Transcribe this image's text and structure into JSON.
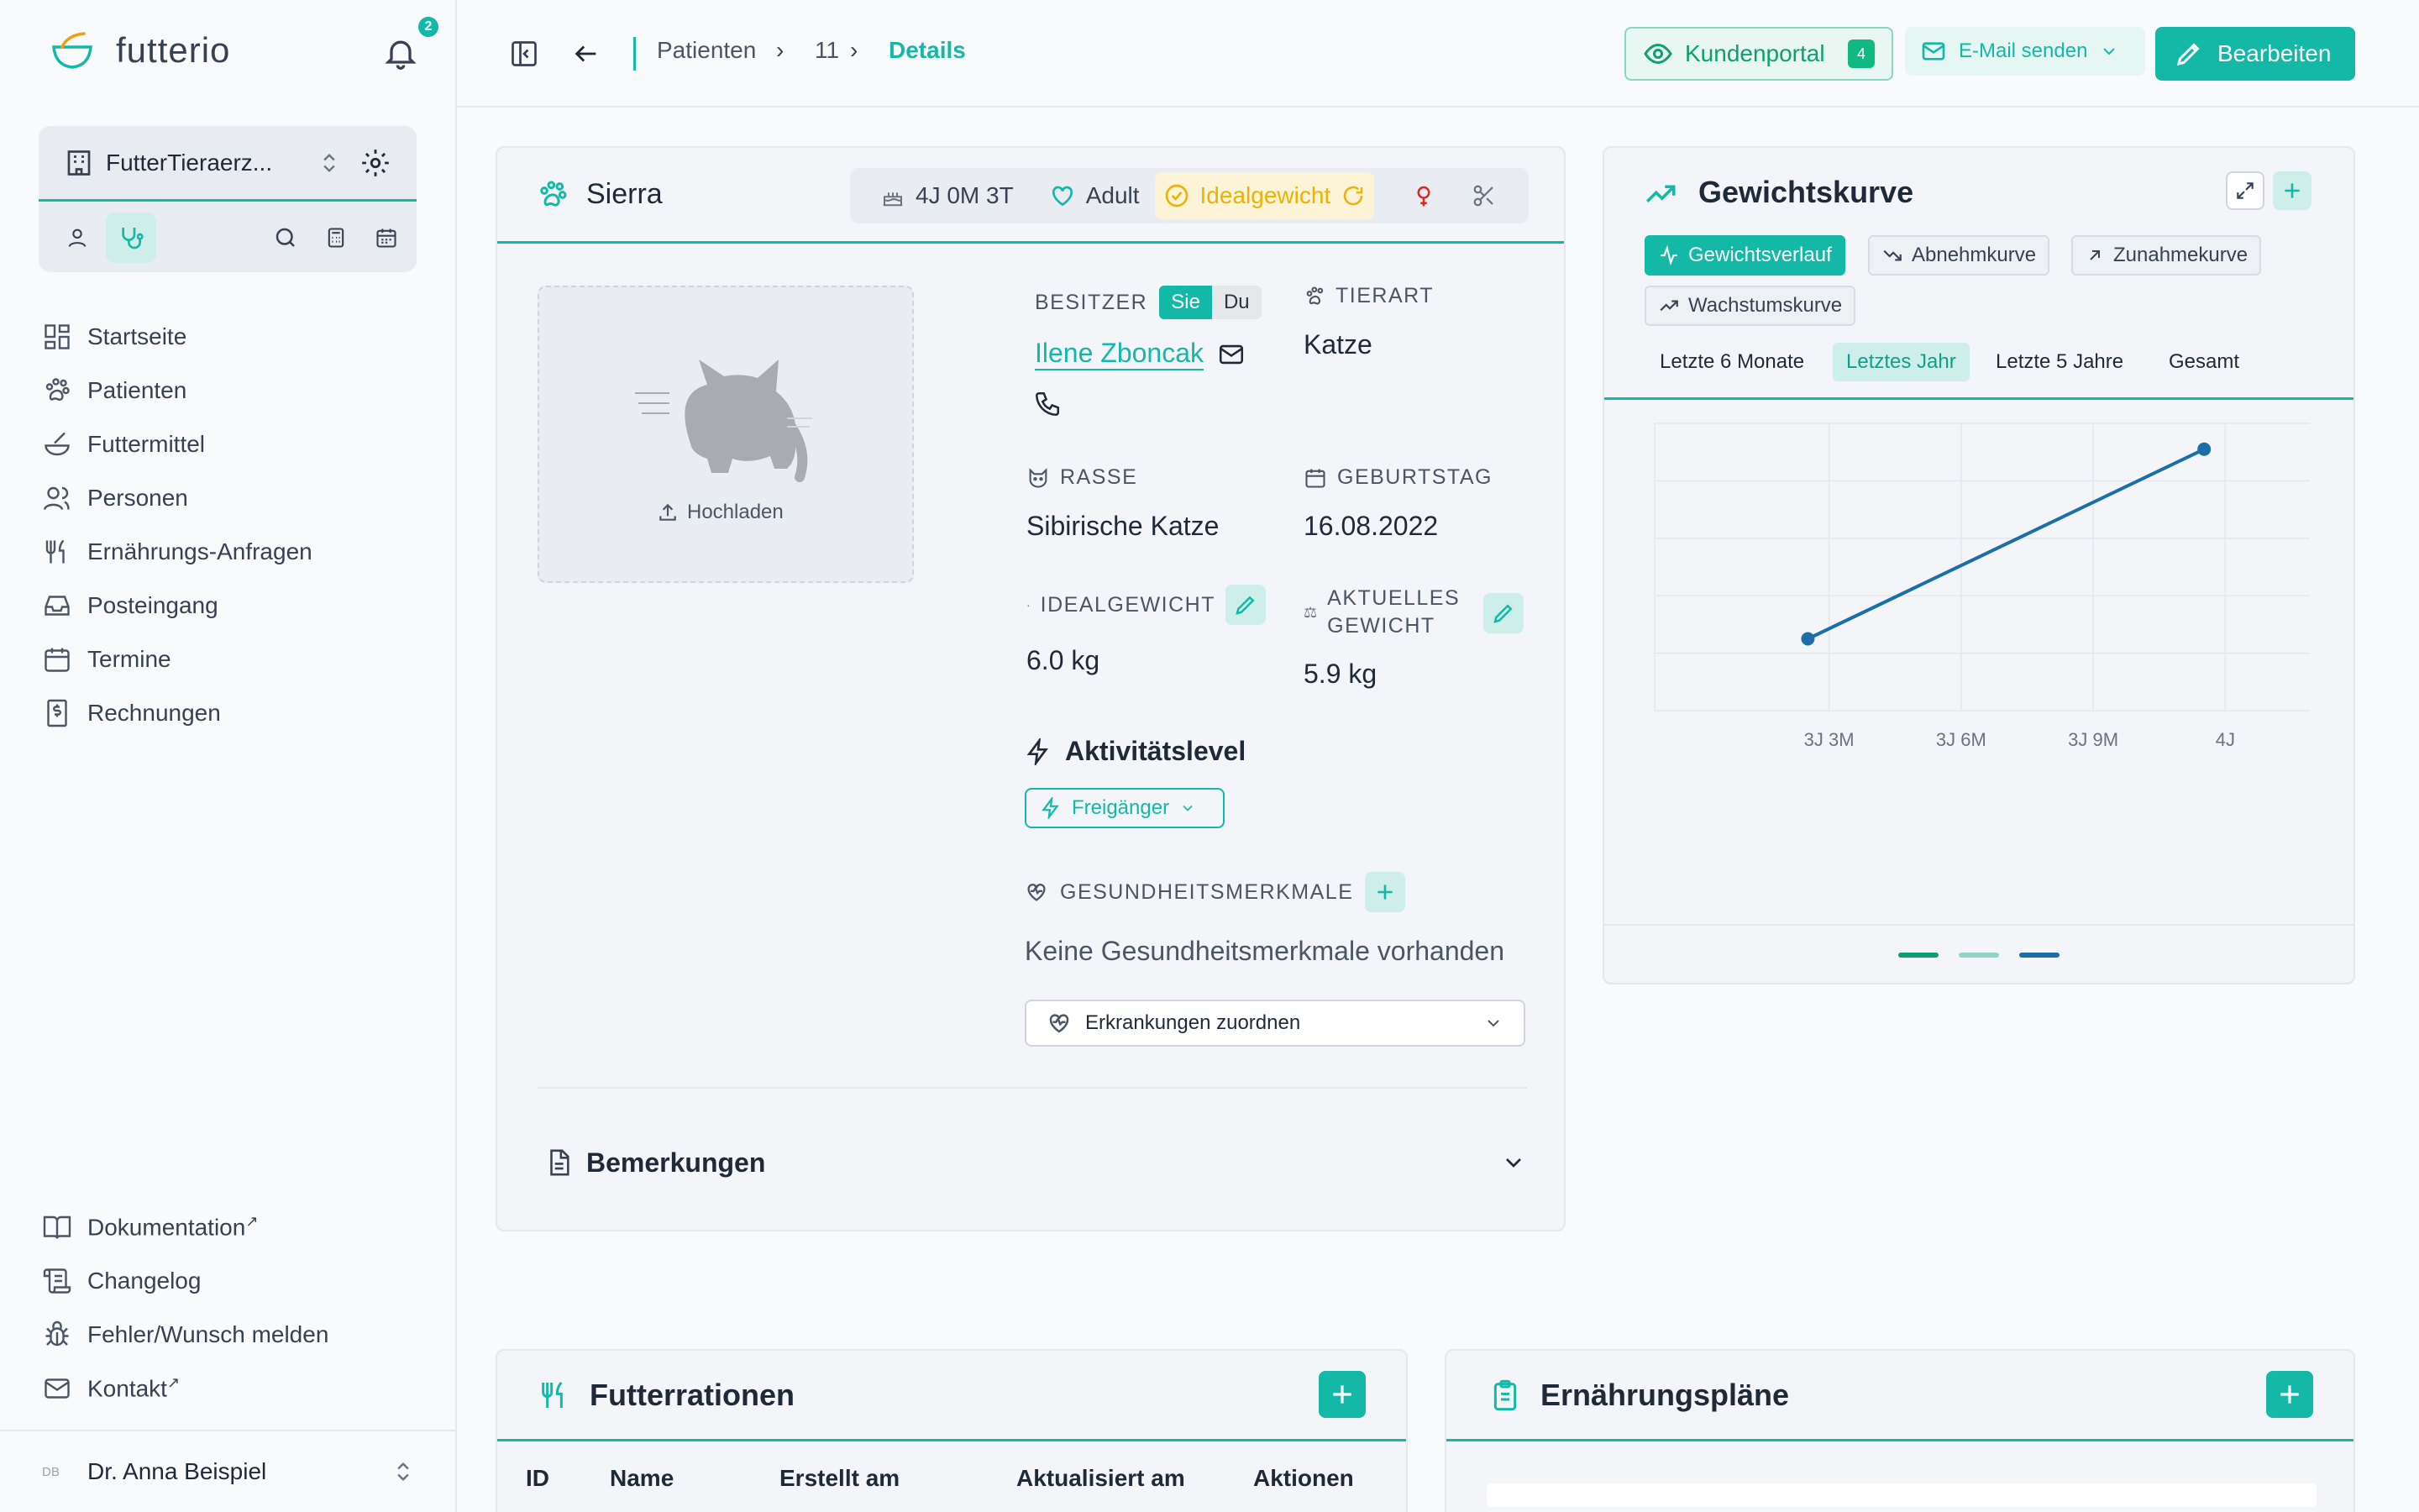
{
  "app": {
    "name": "futterio",
    "notifications": "2"
  },
  "org": {
    "name": "FutterTieraerz..."
  },
  "nav": {
    "items": [
      {
        "label": "Startseite",
        "icon": "dashboard-icon"
      },
      {
        "label": "Patienten",
        "icon": "paw-icon"
      },
      {
        "label": "Futtermittel",
        "icon": "bowl-icon"
      },
      {
        "label": "Personen",
        "icon": "people-icon"
      },
      {
        "label": "Ernährungs-Anfragen",
        "icon": "utensils-icon"
      },
      {
        "label": "Posteingang",
        "icon": "inbox-icon"
      },
      {
        "label": "Termine",
        "icon": "calendar-icon"
      },
      {
        "label": "Rechnungen",
        "icon": "invoice-icon"
      }
    ],
    "footer": [
      {
        "label": "Dokumentation",
        "ext": "↗"
      },
      {
        "label": "Changelog",
        "ext": ""
      },
      {
        "label": "Fehler/Wunsch melden",
        "ext": ""
      },
      {
        "label": "Kontakt",
        "ext": "↗"
      }
    ]
  },
  "user": {
    "initials": "DB",
    "name": "Dr. Anna Beispiel"
  },
  "breadcrumb": {
    "patients": "Patienten",
    "id": "11",
    "current": "Details"
  },
  "actions": {
    "portal": "Kundenportal",
    "portal_count": "4",
    "mail": "E-Mail senden",
    "edit": "Bearbeiten"
  },
  "patient": {
    "name": "Sierra",
    "age": "4J 0M 3T",
    "stage": "Adult",
    "weight_status": "Idealgewicht",
    "upload": "Hochladen",
    "owner_label": "BESITZER",
    "formal": "Sie",
    "informal": "Du",
    "owner_name": "Ilene Zboncak",
    "species_label": "TIERART",
    "species": "Katze",
    "breed_label": "RASSE",
    "breed": "Sibirische Katze",
    "birthday_label": "GEBURTSTAG",
    "birthday": "16.08.2022",
    "ideal_label": "IDEALGEWICHT",
    "ideal": "6.0 kg",
    "current_label_1": "AKTUELLES",
    "current_label_2": "GEWICHT",
    "current": "5.9 kg",
    "activity_title": "Aktivitätslevel",
    "activity": "Freigänger",
    "health_label": "GESUNDHEITSMERKMALE",
    "health_empty": "Keine Gesundheitsmerkmale vorhanden",
    "disease_select": "Erkrankungen zuordnen",
    "remarks": "Bemerkungen"
  },
  "weight": {
    "title": "Gewichtskurve",
    "tabs": [
      "Gewichtsverlauf",
      "Abnehmkurve",
      "Zunahmekurve",
      "Wachstumskurve"
    ],
    "periods": [
      "Letzte 6 Monate",
      "Letztes Jahr",
      "Letzte 5 Jahre",
      "Gesamt"
    ],
    "active_period": 1
  },
  "chart_data": {
    "type": "line",
    "x_ticks": [
      "3J 3M",
      "3J 6M",
      "3J 9M",
      "4J"
    ],
    "x_tick_values": [
      3.25,
      3.5,
      3.75,
      4.0
    ],
    "xlim": [
      2.92,
      4.16
    ],
    "ylim": [
      0,
      1
    ],
    "series": [
      {
        "color": "#1a6fa8",
        "points": [
          [
            3.21,
            0.25
          ],
          [
            3.96,
            0.91
          ]
        ]
      }
    ],
    "grid": true
  },
  "rations": {
    "title": "Futterrationen",
    "columns": [
      "ID",
      "Name",
      "Erstellt am",
      "Aktualisiert am",
      "Aktionen"
    ]
  },
  "plans": {
    "title": "Ernährungspläne"
  }
}
